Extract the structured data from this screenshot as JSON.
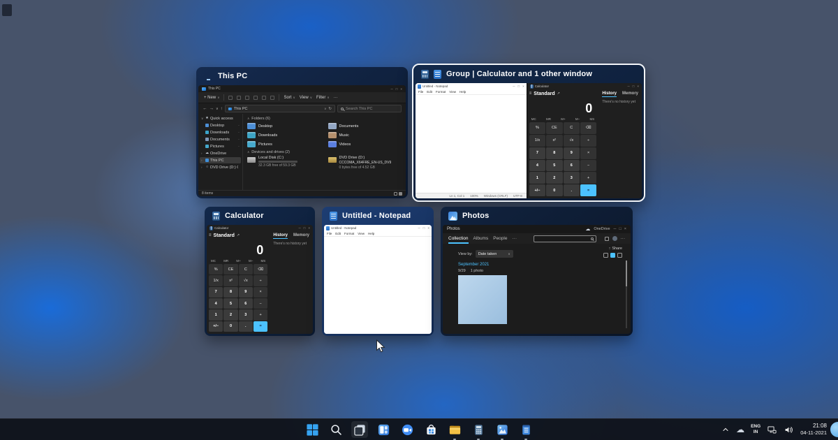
{
  "colors": {
    "accent": "#4cc2ff",
    "selection_border": "#ffffff",
    "taskbar_bg": "#10141c",
    "progress_bar": "#3094dd"
  },
  "chrome": {
    "min": "─",
    "max": "□",
    "close": "×"
  },
  "taskview": {
    "this_pc": {
      "title": "This PC",
      "app_title": "This PC",
      "toolbar": {
        "new": "+ New",
        "sort": "Sort",
        "view": "View",
        "filter": "Filter",
        "more": "···"
      },
      "nav": {
        "back": "←",
        "fwd": "→",
        "down": "∨",
        "up": "↑",
        "refresh": "↻"
      },
      "address_path": "This PC",
      "search_placeholder": "Search This PC",
      "sidebar": [
        {
          "label": "Quick access",
          "glyph": "★",
          "chev": "∨",
          "icon_color": "",
          "pin": "",
          "sel": "",
          "ind": ""
        },
        {
          "label": "Desktop",
          "glyph": "",
          "chev": "",
          "icon_color": "#4d8fd6",
          "pin": "·",
          "sel": "",
          "ind": "ind"
        },
        {
          "label": "Downloads",
          "glyph": "",
          "chev": "",
          "icon_color": "#3aa3c9",
          "pin": "·",
          "sel": "",
          "ind": "ind"
        },
        {
          "label": "Documents",
          "glyph": "",
          "chev": "",
          "icon_color": "#7f97b8",
          "pin": "·",
          "sel": "",
          "ind": "ind"
        },
        {
          "label": "Pictures",
          "glyph": "",
          "chev": "",
          "icon_color": "#44a8cc",
          "pin": "·",
          "sel": "",
          "ind": "ind"
        },
        {
          "label": "OneDrive",
          "glyph": "☁",
          "chev": "›",
          "icon_color": "",
          "pin": "",
          "sel": "",
          "ind": ""
        },
        {
          "label": "This PC",
          "glyph": "",
          "chev": "›",
          "icon_color": "#3f8fd9",
          "pin": "",
          "sel": "sel",
          "ind": ""
        },
        {
          "label": "DVD Drive (D:) C",
          "glyph": "○",
          "chev": "›",
          "icon_color": "",
          "pin": "",
          "sel": "",
          "ind": ""
        }
      ],
      "folders_header": "Folders (6)",
      "folders": [
        {
          "name": "Desktop",
          "color": "#4d8fd6"
        },
        {
          "name": "Documents",
          "color": "#93a7c4"
        },
        {
          "name": "Downloads",
          "color": "#3da4c4"
        },
        {
          "name": "Music",
          "color": "#b5906d"
        },
        {
          "name": "Pictures",
          "color": "#47aacd"
        },
        {
          "name": "Videos",
          "color": "#5b7fe0"
        }
      ],
      "drives_header": "Devices and drives (2)",
      "drive_c": {
        "name": "Local Disk (C:)",
        "detail": "32.3 GB free of 59.3 GB",
        "fill_pct": 45
      },
      "drive_d": {
        "name": "DVD Drive (D:)",
        "label": "CCCOMA_X64FRE_EN-US_DV9",
        "detail": "0 bytes free of 4.52 GB"
      },
      "status": "8 items"
    },
    "group": {
      "title": "Group | Calculator and 1 other window"
    },
    "calculator_win": {
      "title": "Calculator"
    },
    "notepad_win": {
      "title": "Untitled - Notepad"
    },
    "photos_win": {
      "title": "Photos"
    }
  },
  "calculator_app": {
    "app_title": "Calculator",
    "menu_glyph": "≡",
    "mode": "Standard",
    "expand_glyph": "↗",
    "history_tab": "History",
    "memory_tab": "Memory",
    "no_history": "There's no history yet",
    "display": "0",
    "memory_keys": [
      "MC",
      "MR",
      "M+",
      "M−",
      "MS"
    ],
    "keys": [
      {
        "label": "%",
        "type": "op"
      },
      {
        "label": "CE",
        "type": "op"
      },
      {
        "label": "C",
        "type": "op"
      },
      {
        "label": "⌫",
        "type": "op"
      },
      {
        "label": "1/x",
        "type": "op"
      },
      {
        "label": "x²",
        "type": "op"
      },
      {
        "label": "√x",
        "type": "op"
      },
      {
        "label": "÷",
        "type": "op"
      },
      {
        "label": "7",
        "type": "num"
      },
      {
        "label": "8",
        "type": "num"
      },
      {
        "label": "9",
        "type": "num"
      },
      {
        "label": "×",
        "type": "op"
      },
      {
        "label": "4",
        "type": "num"
      },
      {
        "label": "5",
        "type": "num"
      },
      {
        "label": "6",
        "type": "num"
      },
      {
        "label": "−",
        "type": "op"
      },
      {
        "label": "1",
        "type": "num"
      },
      {
        "label": "2",
        "type": "num"
      },
      {
        "label": "3",
        "type": "num"
      },
      {
        "label": "+",
        "type": "op"
      },
      {
        "label": "+/−",
        "type": "num"
      },
      {
        "label": "0",
        "type": "num"
      },
      {
        "label": ".",
        "type": "num"
      },
      {
        "label": "=",
        "type": "eq"
      }
    ]
  },
  "notepad_app": {
    "app_title": "Untitled - Notepad",
    "menus": [
      "File",
      "Edit",
      "Format",
      "View",
      "Help"
    ],
    "status_items": [
      "Ln 1, Col 1",
      "100%",
      "Windows (CRLF)",
      "UTF-8"
    ]
  },
  "photos_app": {
    "app_title": "Photos",
    "onedrive_label": "OneDrive",
    "tabs": [
      {
        "label": "Collection",
        "cls": "active"
      },
      {
        "label": "Albums",
        "cls": ""
      },
      {
        "label": "People",
        "cls": ""
      }
    ],
    "tabs_more": "···",
    "icons_more": "···",
    "view_by_label": "View by:",
    "view_by_value": "Date taken",
    "dd_chev": "∨",
    "share_glyph": "↑",
    "share_label": "Share",
    "month_header": "September 2021",
    "meta_date": "9/29",
    "meta_count": "1 photo"
  },
  "taskbar": {
    "icons": [
      "start",
      "search",
      "task-view",
      "widgets",
      "chat",
      "microsoft-store",
      "file-explorer",
      "calculator",
      "photos",
      "notepad"
    ],
    "open_apps": [
      "file-explorer",
      "calculator",
      "photos",
      "notepad"
    ],
    "tray": {
      "chevron": "hidden-icons-chevron",
      "cloud": "onedrive-cloud",
      "language_line1": "ENG",
      "language_line2": "IN",
      "time": "21:08",
      "date": "04-11-2021"
    }
  }
}
